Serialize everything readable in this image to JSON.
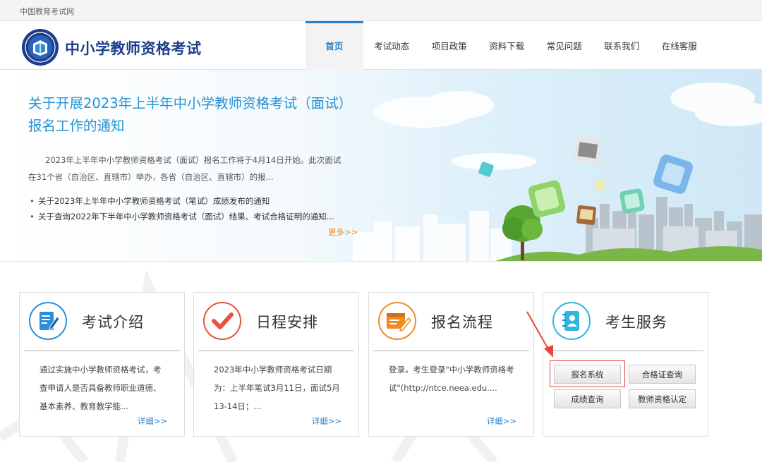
{
  "topbar": {
    "site_name": "中国教育考试网"
  },
  "header": {
    "logo_text": "中小学教师资格考试",
    "nav": [
      {
        "label": "首页",
        "active": true
      },
      {
        "label": "考试动态"
      },
      {
        "label": "项目政策"
      },
      {
        "label": "资料下载"
      },
      {
        "label": "常见问题"
      },
      {
        "label": "联系我们"
      },
      {
        "label": "在线客服"
      }
    ]
  },
  "banner": {
    "title": "关于开展2023年上半年中小学教师资格考试（面试）报名工作的通知",
    "summary": "2023年上半年中小学教师资格考试（面试）报名工作将于4月14日开始。此次面试在31个省（自治区、直辖市）举办，各省（自治区、直辖市）的报...",
    "links": [
      "关于2023年上半年中小学教师资格考试（笔试）成绩发布的通知",
      "关于查询2022年下半年中小学教师资格考试（面试）结果、考试合格证明的通知..."
    ],
    "more": "更多>>"
  },
  "cards": [
    {
      "title": "考试介绍",
      "body": "通过实施中小学教师资格考试，考查申请人是否具备教师职业道德、基本素养、教育教学能...",
      "more": "详细>>",
      "icon": "document-pen-icon",
      "color": "#2a8fd8"
    },
    {
      "title": "日程安排",
      "body": "2023年中小学教师资格考试日期为：上半年笔试3月11日，面试5月13-14日；...",
      "more": "详细>>",
      "icon": "checkmark-icon",
      "color": "#e8533f"
    },
    {
      "title": "报名流程",
      "body": "登录。考生登录\"中小学教师资格考试\"(http://ntce.neea.edu....",
      "more": "详细>>",
      "icon": "signup-form-icon",
      "color": "#f08a24"
    },
    {
      "title": "考生服务",
      "icon": "contact-book-icon",
      "color": "#2fb6e0",
      "buttons": [
        "报名系统",
        "合格证查询",
        "成绩查询",
        "教师资格认定"
      ]
    }
  ]
}
